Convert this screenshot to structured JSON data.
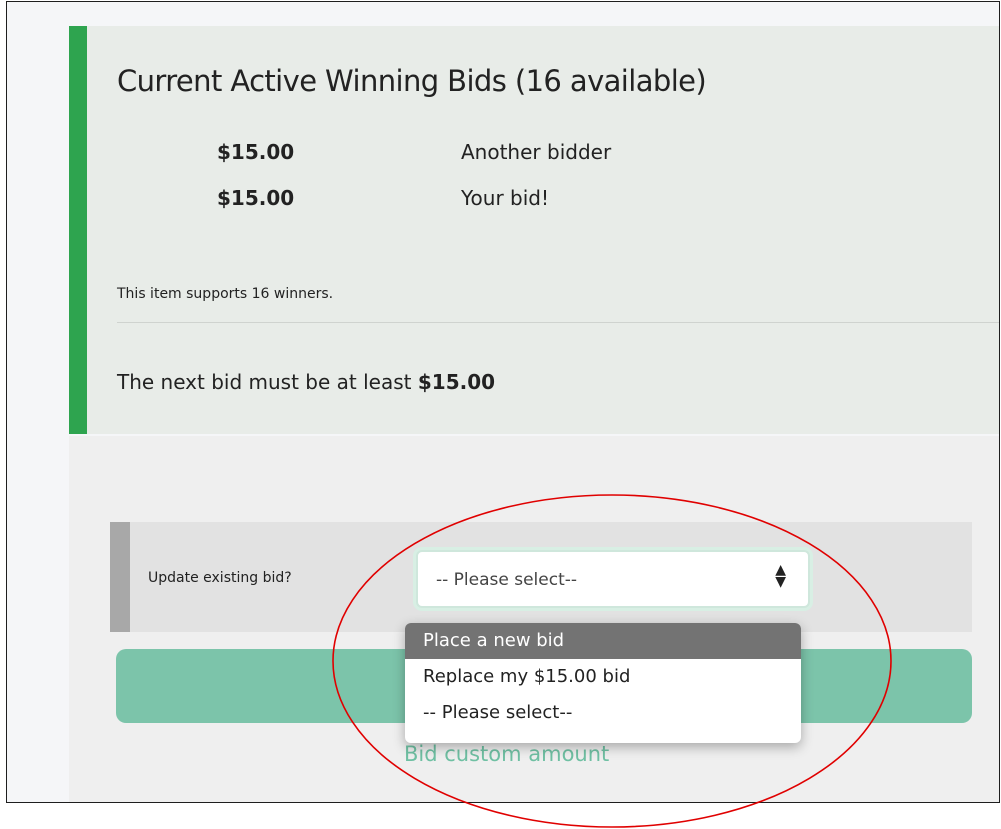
{
  "panel": {
    "title": "Current Active Winning Bids (16 available)",
    "bids": [
      {
        "amount": "$15.00",
        "bidder": "Another bidder"
      },
      {
        "amount": "$15.00",
        "bidder": "Your bid!"
      }
    ],
    "support_note": "This item supports 16 winners.",
    "next_bid_prefix": "The next bid must be at least",
    "next_bid_amount": "$15.00"
  },
  "update": {
    "label": "Update existing bid?",
    "selected": "-- Please select--",
    "options": [
      "Place a new bid",
      "Replace my $15.00 bid",
      "-- Please select--"
    ]
  },
  "links": {
    "custom_amount": "Bid custom amount"
  },
  "colors": {
    "success_bar": "#2ea44f",
    "button": "#7cc4aa",
    "annotation": "#e00000"
  }
}
